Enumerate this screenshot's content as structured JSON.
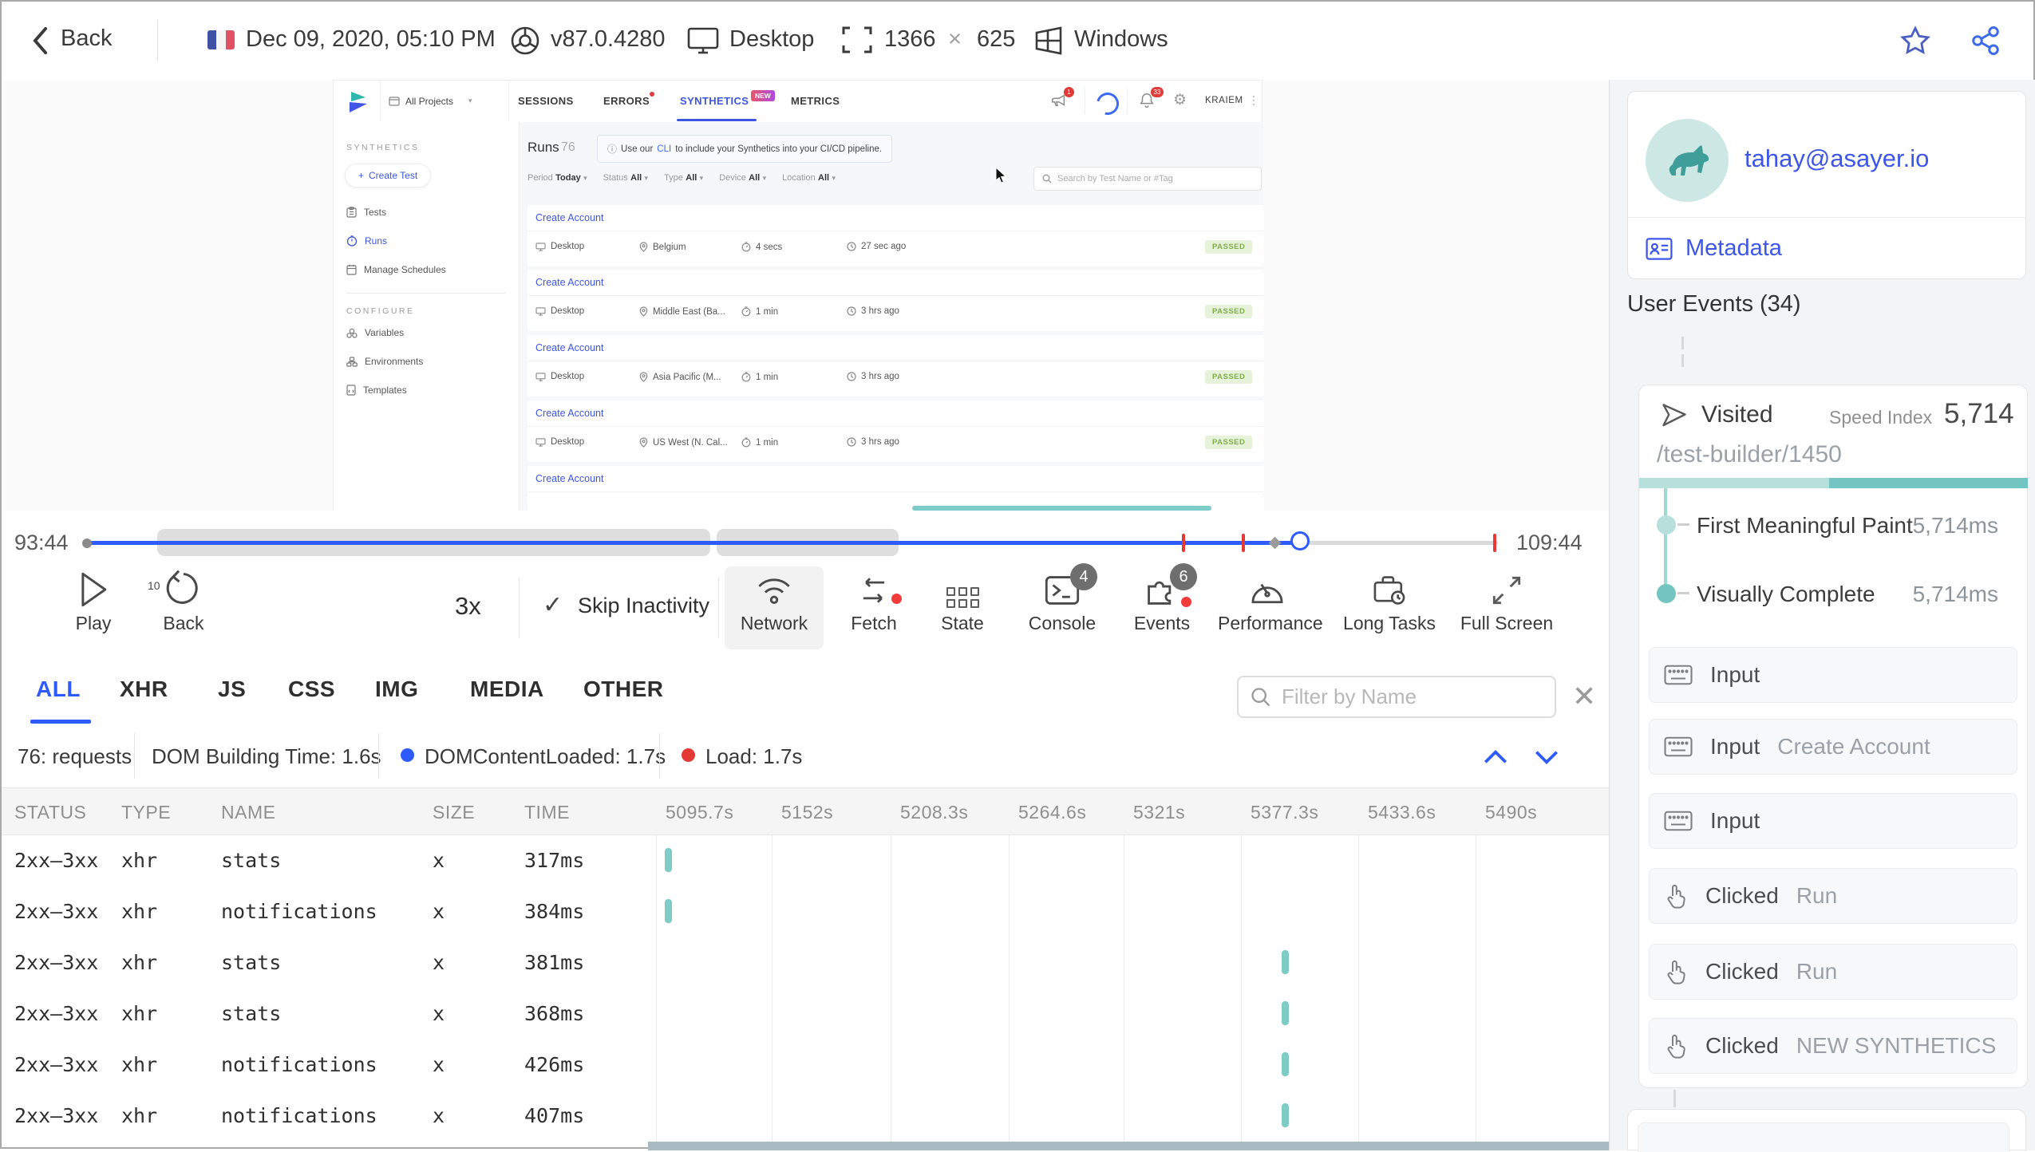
{
  "topbar": {
    "back": "Back",
    "date": "Dec 09, 2020, 05:10 PM",
    "browser_version": "v87.0.4280",
    "device": "Desktop",
    "res_w": "1366",
    "res_x": "×",
    "res_h": "625",
    "os": "Windows"
  },
  "app": {
    "nav": {
      "project_selector": "All Projects",
      "tab_sessions": "SESSIONS",
      "tab_errors": "ERRORS",
      "tab_synthetics": "SYNTHETICS",
      "new_badge": "NEW",
      "tab_metrics": "METRICS",
      "announce_badge": "1",
      "bell_badge": "33",
      "user": "KRAIEM"
    },
    "sidebar": {
      "section_synthetics": "SYNTHETICS",
      "create_test": "Create Test",
      "tests": "Tests",
      "runs": "Runs",
      "manage_schedules": "Manage Schedules",
      "section_configure": "CONFIGURE",
      "variables": "Variables",
      "environments": "Environments",
      "templates": "Templates"
    },
    "runs": {
      "title": "Runs",
      "count": "76",
      "banner_pre": "Use our",
      "banner_link": "CLI",
      "banner_post": "to include your Synthetics into your CI/CD pipeline.",
      "search_placeholder": "Search by Test Name or #Tag",
      "filters": [
        {
          "label": "Period",
          "value": "Today"
        },
        {
          "label": "Status",
          "value": "All"
        },
        {
          "label": "Type",
          "value": "All"
        },
        {
          "label": "Device",
          "value": "All"
        },
        {
          "label": "Location",
          "value": "All"
        }
      ],
      "rows": [
        {
          "name": "Create Account",
          "device": "Desktop",
          "location": "Belgium",
          "duration": "4 secs",
          "ago": "27 sec ago",
          "status": "PASSED"
        },
        {
          "name": "Create Account",
          "device": "Desktop",
          "location": "Middle East (Ba...",
          "duration": "1 min",
          "ago": "3 hrs ago",
          "status": "PASSED"
        },
        {
          "name": "Create Account",
          "device": "Desktop",
          "location": "Asia Pacific (M...",
          "duration": "1 min",
          "ago": "3 hrs ago",
          "status": "PASSED"
        },
        {
          "name": "Create Account",
          "device": "Desktop",
          "location": "US West (N. Cal...",
          "duration": "1 min",
          "ago": "3 hrs ago",
          "status": "PASSED"
        }
      ],
      "partial_row_name": "Create Account"
    }
  },
  "player": {
    "time_current": "93:44",
    "time_total": "109:44",
    "play": "Play",
    "back": "Back",
    "back_amount": "10",
    "speed": "3x",
    "skip_inactivity": "Skip Inactivity",
    "controls": [
      {
        "label": "Network"
      },
      {
        "label": "Fetch"
      },
      {
        "label": "State"
      },
      {
        "label": "Console",
        "badge": "4"
      },
      {
        "label": "Events",
        "badge": "6"
      },
      {
        "label": "Performance"
      },
      {
        "label": "Long Tasks"
      },
      {
        "label": "Full Screen"
      }
    ]
  },
  "network": {
    "tabs": [
      "ALL",
      "XHR",
      "JS",
      "CSS",
      "IMG",
      "MEDIA",
      "OTHER"
    ],
    "filter_placeholder": "Filter by Name",
    "summary": {
      "requests": "76: requests",
      "dom_building": "DOM Building Time: 1.6s",
      "dom_content_loaded": "DOMContentLoaded: 1.7s",
      "load": "Load: 1.7s"
    },
    "columns": {
      "status": "STATUS",
      "type": "TYPE",
      "name": "NAME",
      "size": "SIZE",
      "time": "TIME"
    },
    "time_ticks": [
      "5095.7s",
      "5152s",
      "5208.3s",
      "5264.6s",
      "5321s",
      "5377.3s",
      "5433.6s",
      "5490s"
    ],
    "rows": [
      {
        "status": "2xx–3xx",
        "type": "xhr",
        "name": "stats",
        "size": "x",
        "time": "317ms",
        "mark_at": "5095.7s"
      },
      {
        "status": "2xx–3xx",
        "type": "xhr",
        "name": "notifications",
        "size": "x",
        "time": "384ms",
        "mark_at": "5095.7s"
      },
      {
        "status": "2xx–3xx",
        "type": "xhr",
        "name": "stats",
        "size": "x",
        "time": "381ms",
        "mark_at": "5377.3s"
      },
      {
        "status": "2xx–3xx",
        "type": "xhr",
        "name": "stats",
        "size": "x",
        "time": "368ms",
        "mark_at": "5377.3s"
      },
      {
        "status": "2xx–3xx",
        "type": "xhr",
        "name": "notifications",
        "size": "x",
        "time": "426ms",
        "mark_at": "5377.3s"
      },
      {
        "status": "2xx–3xx",
        "type": "xhr",
        "name": "notifications",
        "size": "x",
        "time": "407ms",
        "mark_at": "5377.3s"
      }
    ]
  },
  "user_panel": {
    "email": "tahay@asayer.io",
    "metadata": "Metadata",
    "events_title": "User Events (34)",
    "visited": {
      "label": "Visited",
      "speed_index_label": "Speed Index",
      "speed_index": "5,714",
      "url": "/test-builder/1450",
      "metrics": [
        {
          "label": "First Meaningful Paint",
          "value": "5,714ms"
        },
        {
          "label": "Visually Complete",
          "value": "5,714ms"
        }
      ]
    },
    "events": [
      {
        "type": "Input",
        "value": ""
      },
      {
        "type": "Input",
        "value": "Create Account"
      },
      {
        "type": "Input",
        "value": ""
      },
      {
        "type": "Clicked",
        "value": "Run"
      },
      {
        "type": "Clicked",
        "value": "Run"
      },
      {
        "type": "Clicked",
        "value": "NEW SYNTHETICS"
      }
    ]
  },
  "colors": {
    "accent_blue": "#2e5bff",
    "teal": "#7fccc6",
    "red": "#e53935",
    "passed_green": "#7fae4a"
  }
}
